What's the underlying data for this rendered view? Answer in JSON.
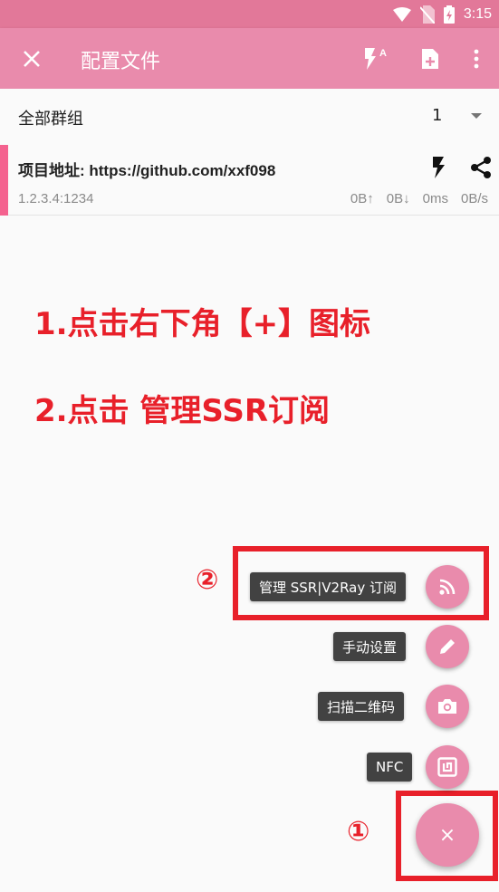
{
  "status_bar": {
    "time": "3:15",
    "icons": [
      "wifi-icon",
      "no-sim-icon",
      "battery-charging-icon"
    ]
  },
  "toolbar": {
    "title": "配置文件",
    "actions": [
      "close-icon",
      "flash-auto-icon",
      "new-file-icon",
      "more-vert-icon"
    ]
  },
  "group_selector": {
    "label": "全部群组",
    "count": "1"
  },
  "server": {
    "name": "项目地址: https://github.com/xxf098",
    "address": "1.2.3.4:1234",
    "upload": "0B↑",
    "download": "0B↓",
    "latency": "0ms",
    "speed": "0B/s",
    "icons": [
      "flash-icon",
      "share-icon"
    ]
  },
  "annotations": {
    "step1": "1.点击右下角【+】图标",
    "step2": "2.点击 管理SSR订阅",
    "marker1": "①",
    "marker2": "②"
  },
  "speed_dial": {
    "items": [
      {
        "label": "管理 SSR|V2Ray 订阅",
        "icon": "rss-icon"
      },
      {
        "label": "手动设置",
        "icon": "pencil-icon"
      },
      {
        "label": "扫描二维码",
        "icon": "camera-icon"
      },
      {
        "label": "NFC",
        "icon": "nfc-icon"
      }
    ],
    "main_icon": "close-icon",
    "main_glyph": "×"
  },
  "colors": {
    "status_bar": "#e27899",
    "toolbar": "#e98bac",
    "accent": "#f4628f",
    "annotation_red": "#e8202a"
  }
}
